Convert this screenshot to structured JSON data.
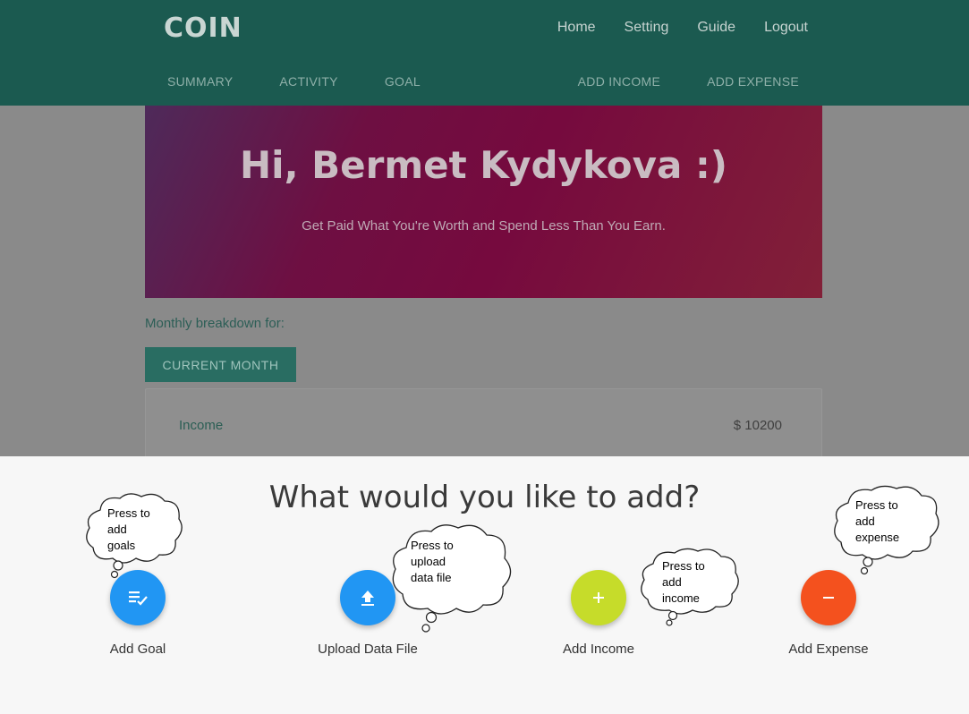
{
  "header": {
    "logo": "COIN",
    "top_nav": [
      "Home",
      "Setting",
      "Guide",
      "Logout"
    ],
    "sub_nav_left": [
      "SUMMARY",
      "ACTIVITY",
      "GOAL"
    ],
    "sub_nav_right": [
      "ADD INCOME",
      "ADD EXPENSE"
    ]
  },
  "hero": {
    "title": "Hi, Bermet Kydykova :)",
    "subtitle": "Get Paid What You're Worth and Spend Less Than You Earn."
  },
  "breakdown": {
    "label": "Monthly breakdown for:",
    "button": "CURRENT MONTH",
    "income_label": "Income",
    "income_value": "$ 10200"
  },
  "sheet": {
    "title": "What would you like to add?",
    "actions": [
      {
        "label": "Add Goal",
        "icon": "goal-list-check-icon",
        "color": "#2196f3",
        "tooltip": "Press to\nadd\ngoals"
      },
      {
        "label": "Upload Data File",
        "icon": "upload-icon",
        "color": "#2196f3",
        "tooltip": "Press to\nupload\ndata file"
      },
      {
        "label": "Add Income",
        "icon": "plus-icon",
        "color": "#c6dc2a",
        "tooltip": "Press to\nadd\nincome"
      },
      {
        "label": "Add Expense",
        "icon": "minus-icon",
        "color": "#f4511e",
        "tooltip": "Press to\nadd\nexpense"
      }
    ]
  },
  "colors": {
    "appbar": "#1b5a50",
    "sheet_bg": "#f7f7f7",
    "overlay": "#8a8a8a"
  }
}
